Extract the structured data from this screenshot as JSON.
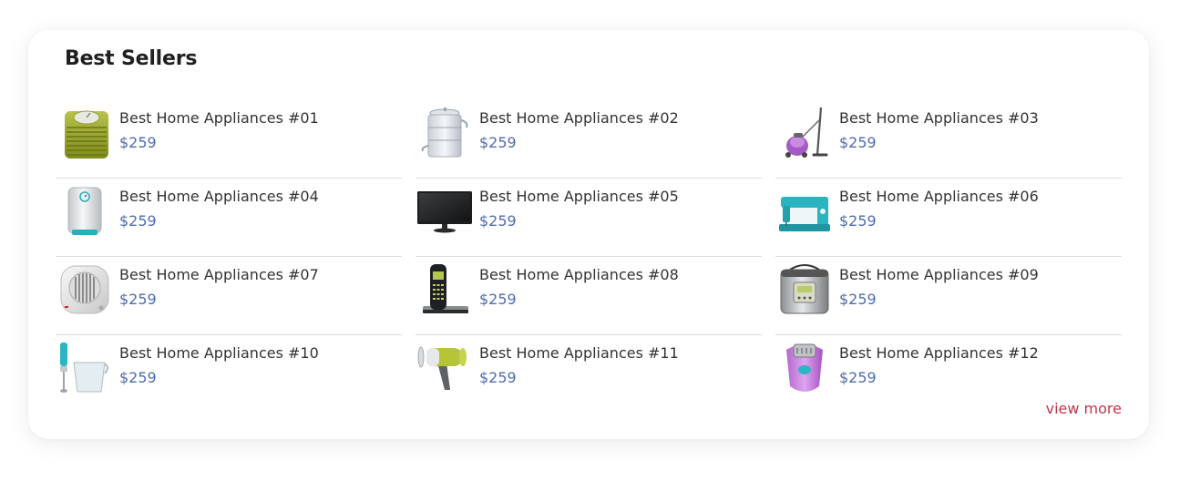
{
  "section": {
    "title": "Best Sellers",
    "view_more_label": "view more"
  },
  "colors": {
    "price": "#4e6cae",
    "link": "#c0364a"
  },
  "products": [
    {
      "name": "Best Home Appliances #01",
      "price": "$259",
      "icon": "bathroom-scale-icon"
    },
    {
      "name": "Best Home Appliances #02",
      "price": "$259",
      "icon": "steamer-pot-icon"
    },
    {
      "name": "Best Home Appliances #03",
      "price": "$259",
      "icon": "vacuum-cleaner-icon"
    },
    {
      "name": "Best Home Appliances #04",
      "price": "$259",
      "icon": "water-heater-icon"
    },
    {
      "name": "Best Home Appliances #05",
      "price": "$259",
      "icon": "tv-monitor-icon"
    },
    {
      "name": "Best Home Appliances #06",
      "price": "$259",
      "icon": "sewing-machine-icon"
    },
    {
      "name": "Best Home Appliances #07",
      "price": "$259",
      "icon": "fan-heater-icon"
    },
    {
      "name": "Best Home Appliances #08",
      "price": "$259",
      "icon": "cordless-phone-icon"
    },
    {
      "name": "Best Home Appliances #09",
      "price": "$259",
      "icon": "rice-cooker-icon"
    },
    {
      "name": "Best Home Appliances #10",
      "price": "$259",
      "icon": "hand-blender-icon"
    },
    {
      "name": "Best Home Appliances #11",
      "price": "$259",
      "icon": "hair-dryer-icon"
    },
    {
      "name": "Best Home Appliances #12",
      "price": "$259",
      "icon": "epilator-icon"
    }
  ]
}
